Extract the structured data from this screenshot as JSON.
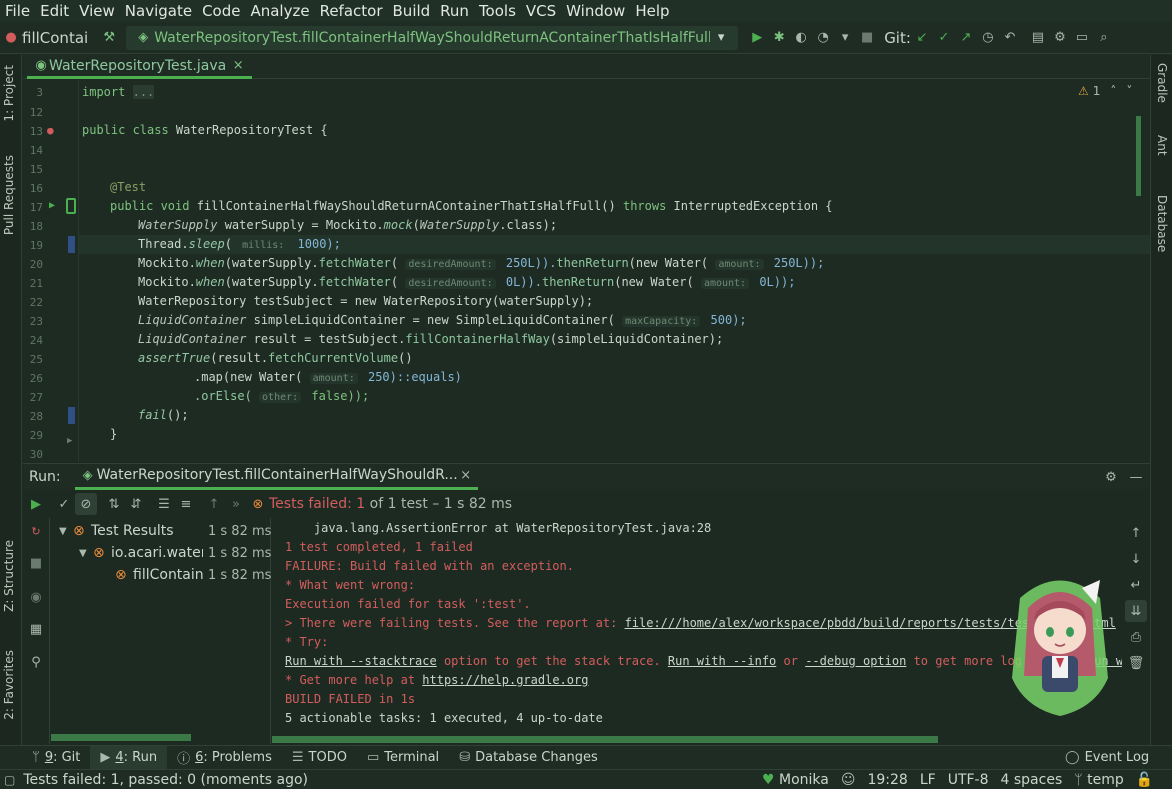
{
  "menu": [
    "File",
    "Edit",
    "View",
    "Navigate",
    "Code",
    "Analyze",
    "Refactor",
    "Build",
    "Run",
    "Tools",
    "VCS",
    "Window",
    "Help"
  ],
  "toolbar": {
    "project": "fillContai",
    "run_config": "WaterRepositoryTest.fillContainerHalfWayShouldReturnAContainerThatIsHalfFull",
    "git_label": "Git:"
  },
  "left_tabs": [
    "1: Project",
    "Pull Requests",
    "Z: Structure",
    "2: Favorites"
  ],
  "right_tabs": [
    "Gradle",
    "Ant",
    "Database"
  ],
  "editor_tab": "WaterRepositoryTest.java",
  "warnings": "1",
  "code": {
    "line_numbers": [
      "3",
      "12",
      "13",
      "14",
      "15",
      "16",
      "17",
      "18",
      "19",
      "20",
      "21",
      "22",
      "23",
      "24",
      "25",
      "26",
      "27",
      "28",
      "29",
      "30"
    ],
    "l3_kw": "import",
    "l3_rest": "...",
    "l13_a": "public class ",
    "l13_b": "WaterRepositoryTest {",
    "l16": "@Test",
    "l17_a": "public void ",
    "l17_b": "fillContainerHalfWayShouldReturnAContainerThatIsHalfFull() ",
    "l17_c": "throws ",
    "l17_d": "InterruptedException {",
    "l18_a": "WaterSupply",
    "l18_b": " waterSupply = Mockito.",
    "l18_c": "mock",
    "l18_d": "(",
    "l18_e": "WaterSupply",
    "l18_f": ".class);",
    "l19_a": "Thread.",
    "l19_b": "sleep",
    "l19_c": "( ",
    "l19_hint": "millis:",
    "l19_d": " 1000);",
    "l20_a": "Mockito.",
    "l20_b": "when",
    "l20_c": "(waterSupply.",
    "l20_d": "fetchWater",
    "l20_e": "( ",
    "l20_hint": "desiredAmount:",
    "l20_f": " 250L)).",
    "l20_g": "thenReturn",
    "l20_h": "(new Water( ",
    "l20_hint2": "amount:",
    "l20_i": " 250L));",
    "l21_a": "Mockito.",
    "l21_b": "when",
    "l21_c": "(waterSupply.",
    "l21_d": "fetchWater",
    "l21_e": "( ",
    "l21_hint": "desiredAmount:",
    "l21_f": " 0L)).",
    "l21_g": "thenReturn",
    "l21_h": "(new Water( ",
    "l21_hint2": "amount:",
    "l21_i": " 0L));",
    "l22": "WaterRepository testSubject = new WaterRepository(waterSupply);",
    "l23_a": "LiquidContainer",
    "l23_b": " simpleLiquidContainer = new SimpleLiquidContainer( ",
    "l23_hint": "maxCapacity:",
    "l23_c": " 500);",
    "l24_a": "LiquidContainer",
    "l24_b": " result = testSubject.",
    "l24_c": "fillContainerHalfWay",
    "l24_d": "(simpleLiquidContainer);",
    "l25_a": "assertTrue",
    "l25_b": "(result.",
    "l25_c": "fetchCurrentVolume",
    "l25_d": "()",
    "l26_a": ".map(new Water( ",
    "l26_hint": "amount:",
    "l26_b": " 250)::equals)",
    "l27_a": ".orElse( ",
    "l27_hint": "other:",
    "l27_b": " false));",
    "l28_a": "fail",
    "l28_b": "();",
    "l29": "}"
  },
  "run": {
    "label": "Run:",
    "tab": "WaterRepositoryTest.fillContainerHalfWayShouldR...",
    "summary_a": "Tests failed: ",
    "summary_b": "1",
    "summary_c": " of 1 test – 1 s 82 ms",
    "tree": [
      {
        "label": "Test Results",
        "time": "1 s 82 ms"
      },
      {
        "label": "io.acari.water",
        "time": "1 s 82 ms"
      },
      {
        "label": "fillContain",
        "time": "1 s 82 ms"
      }
    ]
  },
  "console": {
    "l1": "    java.lang.AssertionError at WaterRepositoryTest.java:28",
    "l2": "1 test completed, 1 failed",
    "l3": "FAILURE: Build failed with an exception.",
    "l4": "* What went wrong:",
    "l5": "Execution failed for task ':test'.",
    "l6_a": "> There were failing tests. See the report at: ",
    "l6_link": "file:///home/alex/workspace/pbdd/build/reports/tests/test/index.html",
    "l7": "* Try:",
    "l8_a": "Run with --stacktrace",
    "l8_b": " option to get the stack trace. ",
    "l8_c": "Run with --info",
    "l8_d": " or ",
    "l8_e": "--debug option",
    "l8_f": " to get more log output. ",
    "l8_g": "Run wit",
    "l9_a": "* Get more help at ",
    "l9_link": "https://help.gradle.org",
    "l10": "BUILD FAILED in 1s",
    "l11": "5 actionable tasks: 1 executed, 4 up-to-date"
  },
  "toolwindows": [
    {
      "key": "9",
      "label": ": Git"
    },
    {
      "key": "4",
      "label": ": Run"
    },
    {
      "key": "6",
      "label": ": Problems"
    },
    {
      "label": "TODO"
    },
    {
      "label": "Terminal"
    },
    {
      "label": "Database Changes"
    }
  ],
  "event_log": "Event Log",
  "status": {
    "message": "Tests failed: 1, passed: 0 (moments ago)",
    "theme": "Monika",
    "time": "19:28",
    "line_sep": "LF",
    "encoding": "UTF-8",
    "indent": "4 spaces",
    "branch": "temp"
  },
  "colors": {
    "accent": "#4caf50",
    "error": "#d35d5d",
    "background": "#1d2a22"
  }
}
